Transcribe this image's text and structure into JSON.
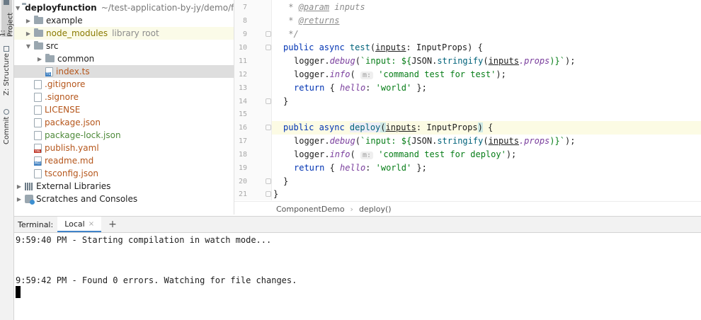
{
  "tool_strip": {
    "project_tab": "1: Project",
    "structure_tab": "Z: Structure",
    "commit_tab": "Commit"
  },
  "project_tree": {
    "root": {
      "name": "deployfunction",
      "path": "~/test-application-by-jy/demo/f"
    },
    "items": [
      {
        "label": "example",
        "type": "folder"
      },
      {
        "label": "node_modules",
        "type": "folder",
        "suffix": "library root"
      },
      {
        "label": "src",
        "type": "folder"
      },
      {
        "label": "common",
        "type": "folder"
      },
      {
        "label": "index.ts",
        "type": "ts"
      },
      {
        "label": ".gitignore",
        "type": "file"
      },
      {
        "label": ".signore",
        "type": "file"
      },
      {
        "label": "LICENSE",
        "type": "file"
      },
      {
        "label": "package.json",
        "type": "file"
      },
      {
        "label": "package-lock.json",
        "type": "file"
      },
      {
        "label": "publish.yaml",
        "type": "yml"
      },
      {
        "label": "readme.md",
        "type": "md"
      },
      {
        "label": "tsconfig.json",
        "type": "file"
      },
      {
        "label": "External Libraries",
        "type": "lib"
      },
      {
        "label": "Scratches and Consoles",
        "type": "scratch"
      }
    ]
  },
  "editor": {
    "line_numbers": [
      "7",
      "8",
      "9",
      "10",
      "11",
      "12",
      "13",
      "14",
      "15",
      "16",
      "17",
      "18",
      "19",
      "20",
      "21"
    ],
    "code": {
      "l7_star": " * ",
      "l7_tag": "@param",
      "l7_rest": " inputs",
      "l8_star": " * ",
      "l8_tag": "@returns",
      "l9": " */",
      "l10_kw": "public async ",
      "l10_fn": "test",
      "l10_paren": "(",
      "l10_param": "inputs",
      "l10_rest": ": InputProps) {",
      "l11_a": "logger.",
      "l11_m": "debug",
      "l11_b": "(",
      "l11_s1": "`input: ${",
      "l11_json": "JSON.",
      "l11_str": "stringify",
      "l11_c": "(",
      "l11_inputs": "inputs",
      "l11_props": ".props",
      "l11_d": ")}`",
      "l11_e": ");",
      "l12_a": "logger.",
      "l12_m": "info",
      "l12_b": "( ",
      "l12_hint": "m:",
      "l12_s": " 'command test for test'",
      "l12_e": ");",
      "l13_kw": "return",
      "l13_a": " { ",
      "l13_key": "hello",
      "l13_b": ": ",
      "l13_s": "'world'",
      "l13_c": " };",
      "l14": "}",
      "l16_kw": "public async ",
      "l16_fn": "deploy",
      "l16_paren": "(",
      "l16_param": "inputs",
      "l16_rest": ": InputProps",
      "l16_close": ")",
      "l16_end": " {",
      "l17_a": "logger.",
      "l17_m": "debug",
      "l17_b": "(",
      "l17_s1": "`input: ${",
      "l17_json": "JSON.",
      "l17_str": "stringify",
      "l17_c": "(",
      "l17_inputs": "inputs",
      "l17_props": ".props",
      "l17_d": ")}`",
      "l17_e": ");",
      "l18_a": "logger.",
      "l18_m": "info",
      "l18_b": "( ",
      "l18_hint": "m:",
      "l18_s": " 'command test for deploy'",
      "l18_e": ");",
      "l19_kw": "return",
      "l19_a": " { ",
      "l19_key": "hello",
      "l19_b": ": ",
      "l19_s": "'world'",
      "l19_c": " };",
      "l20": "}",
      "l21": "}"
    }
  },
  "breadcrumb": {
    "class_name": "ComponentDemo",
    "separator": "›",
    "method_name": "deploy()"
  },
  "terminal": {
    "label": "Terminal:",
    "tab_label": "Local",
    "close_glyph": "×",
    "add_glyph": "+",
    "lines": [
      "9:59:40 PM - Starting compilation in watch mode...",
      "9:59:42 PM - Found 0 errors. Watching for file changes."
    ]
  },
  "colors": {
    "accent": "#4083c9",
    "keyword": "#0033b3",
    "string": "#067d17",
    "selection": "#dedede"
  }
}
